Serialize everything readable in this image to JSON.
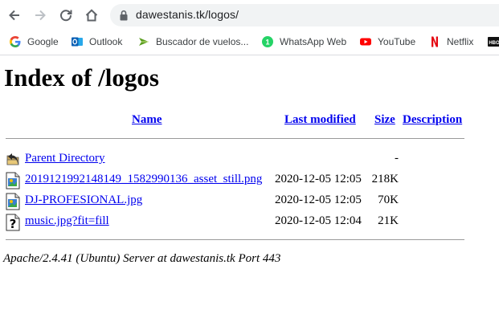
{
  "browser": {
    "url": "dawestanis.tk/logos/",
    "bookmarks": [
      {
        "label": "Google",
        "icon": "google-icon"
      },
      {
        "label": "Outlook",
        "icon": "outlook-icon"
      },
      {
        "label": "Buscador de vuelos...",
        "icon": "flight-search-icon"
      },
      {
        "label": "WhatsApp Web",
        "icon": "whatsapp-icon"
      },
      {
        "label": "YouTube",
        "icon": "youtube-icon"
      },
      {
        "label": "Netflix",
        "icon": "netflix-icon"
      },
      {
        "label": "",
        "icon": "hbo-icon"
      }
    ]
  },
  "page": {
    "title": "Index of /logos",
    "columns": {
      "name": "Name",
      "last_modified": "Last modified",
      "size": "Size",
      "description": "Description"
    },
    "rows": [
      {
        "name": "Parent Directory",
        "modified": "",
        "size": "-",
        "icon": "back-folder-icon"
      },
      {
        "name": "2019121992148149_1582990136_asset_still.png",
        "modified": "2020-12-05 12:05",
        "size": "218K",
        "icon": "image-file-icon"
      },
      {
        "name": "DJ-PROFESIONAL.jpg",
        "modified": "2020-12-05 12:05",
        "size": "70K",
        "icon": "image-file-icon"
      },
      {
        "name": "music.jpg?fit=fill",
        "modified": "2020-12-05 12:04",
        "size": "21K",
        "icon": "unknown-file-icon"
      }
    ],
    "footer": "Apache/2.4.41 (Ubuntu) Server at dawestanis.tk Port 443"
  }
}
